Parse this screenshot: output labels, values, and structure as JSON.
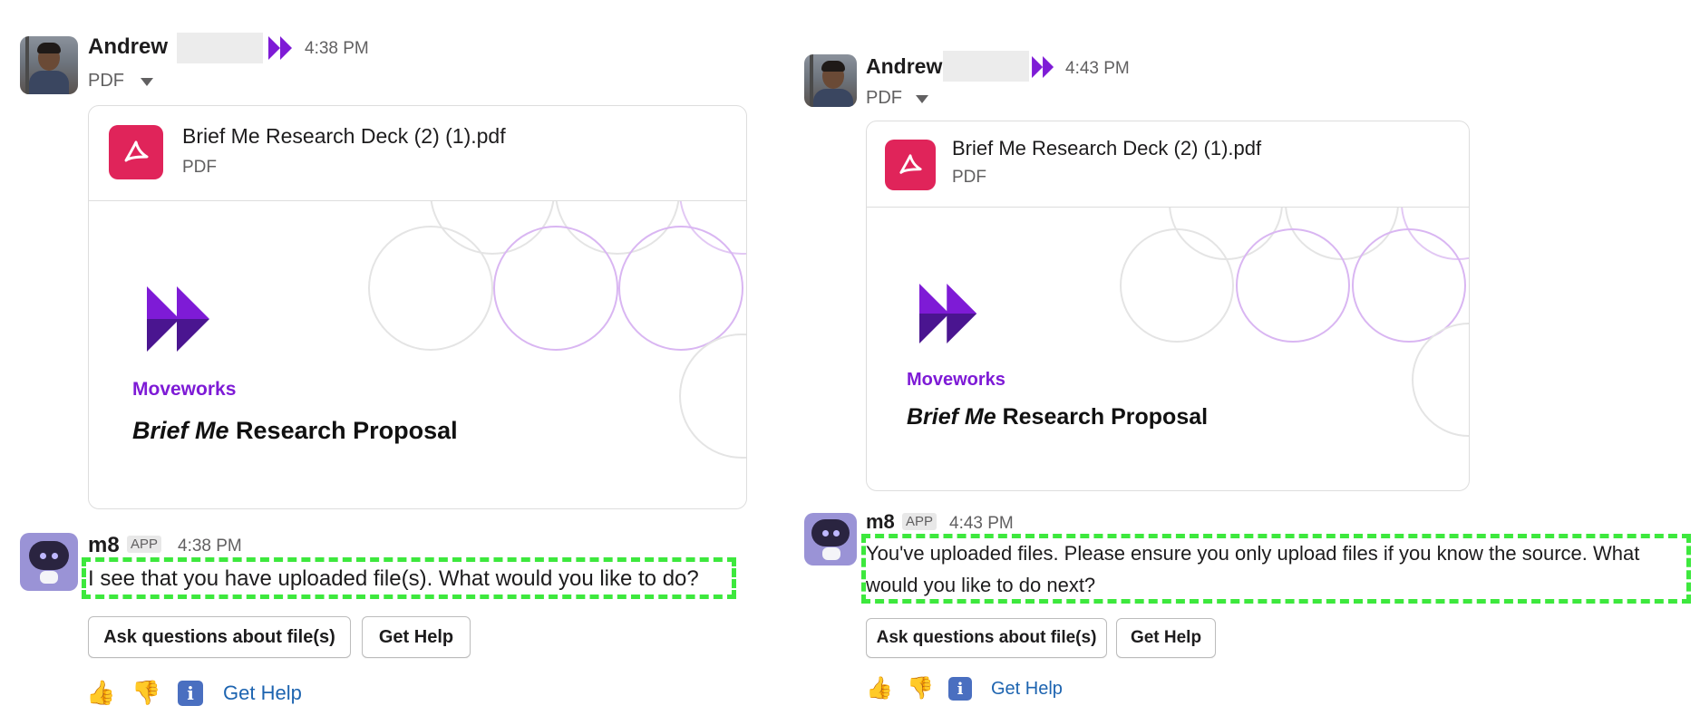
{
  "left": {
    "user_message": {
      "author": "Andrew",
      "time": "4:38 PM",
      "type_label": "PDF",
      "file": {
        "title": "Brief Me Research Deck (2) (1).pdf",
        "type": "PDF"
      },
      "preview": {
        "brand": "Moveworks",
        "title_emphasis": "Brief Me",
        "title_rest": " Research Proposal"
      }
    },
    "bot_message": {
      "author": "m8",
      "badge": "APP",
      "time": "4:38 PM",
      "text": "I see that you have uploaded file(s). What would you like to do?",
      "buttons": [
        "Ask questions about file(s)",
        "Get Help"
      ],
      "footer_link": "Get Help"
    }
  },
  "right": {
    "user_message": {
      "author": "Andrew",
      "time": "4:43 PM",
      "type_label": "PDF",
      "file": {
        "title": "Brief Me Research Deck (2) (1).pdf",
        "type": "PDF"
      },
      "preview": {
        "brand": "Moveworks",
        "title_emphasis": "Brief Me",
        "title_rest": " Research Proposal"
      }
    },
    "bot_message": {
      "author": "m8",
      "badge": "APP",
      "time": "4:43 PM",
      "text": "You've uploaded files. Please ensure you only upload files if you know the source. What would you like to do next?",
      "buttons": [
        "Ask questions about file(s)",
        "Get Help"
      ],
      "footer_link": "Get Help"
    }
  },
  "icons": {
    "brand_mark": "moveworks-logo-icon",
    "file": "pdf-file-icon",
    "thumbs_up": "👍",
    "thumbs_down": "👎",
    "info": "i"
  },
  "colors": {
    "highlight": "#3de83d",
    "brand_purple": "#7e1bd6",
    "pdf_red": "#e0245a",
    "link_blue": "#1d64b0"
  }
}
